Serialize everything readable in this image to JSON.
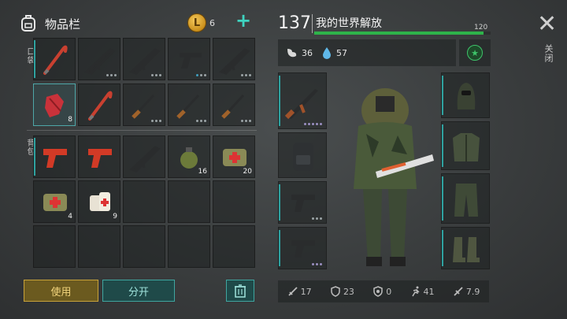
{
  "header": {
    "title": "物品栏",
    "coins": "6",
    "coin_symbol": "L",
    "plus": "+"
  },
  "side_labels": {
    "pocket": "口袋",
    "backpack": "背包"
  },
  "pocket_items": [
    {
      "icon": "crowbar-icon",
      "count": ""
    },
    {
      "icon": "rifle-icon",
      "count": ""
    },
    {
      "icon": "rifle-icon",
      "count": ""
    },
    {
      "icon": "pistol-icon",
      "count": ""
    },
    {
      "icon": "rifle-icon",
      "count": ""
    },
    {
      "icon": "cloth-icon",
      "count": "8"
    },
    {
      "icon": "crowbar-icon",
      "count": ""
    },
    {
      "icon": "shotgun-icon",
      "count": ""
    },
    {
      "icon": "shotgun-icon",
      "count": ""
    },
    {
      "icon": "shotgun-icon",
      "count": ""
    }
  ],
  "backpack_items": [
    {
      "icon": "flare-gun-icon",
      "count": ""
    },
    {
      "icon": "flare-gun-icon",
      "count": ""
    },
    {
      "icon": "rifle-icon",
      "count": ""
    },
    {
      "icon": "grenade-icon",
      "count": "16"
    },
    {
      "icon": "medkit-icon",
      "count": "20"
    },
    {
      "icon": "medkit-icon",
      "count": "4"
    },
    {
      "icon": "bandage-icon",
      "count": "9"
    }
  ],
  "buttons": {
    "use": "使用",
    "split": "分开"
  },
  "character": {
    "level": "137",
    "name": "我的世界解放",
    "hp_max": "120",
    "hp_fraction": 0.96,
    "hunger": "36",
    "thirst": "57",
    "star": "★"
  },
  "close": {
    "symbol": "✕",
    "label": "关闭"
  },
  "stats": [
    {
      "icon": "sword-icon",
      "value": "17"
    },
    {
      "icon": "shield-icon",
      "value": "23"
    },
    {
      "icon": "radiation-icon",
      "value": "0"
    },
    {
      "icon": "run-icon",
      "value": "41"
    },
    {
      "icon": "weight-icon",
      "value": "7.9"
    }
  ],
  "colors": {
    "accent": "#2fa2a0",
    "use_button": "#c9a33a",
    "hp": "#2eb34a"
  }
}
